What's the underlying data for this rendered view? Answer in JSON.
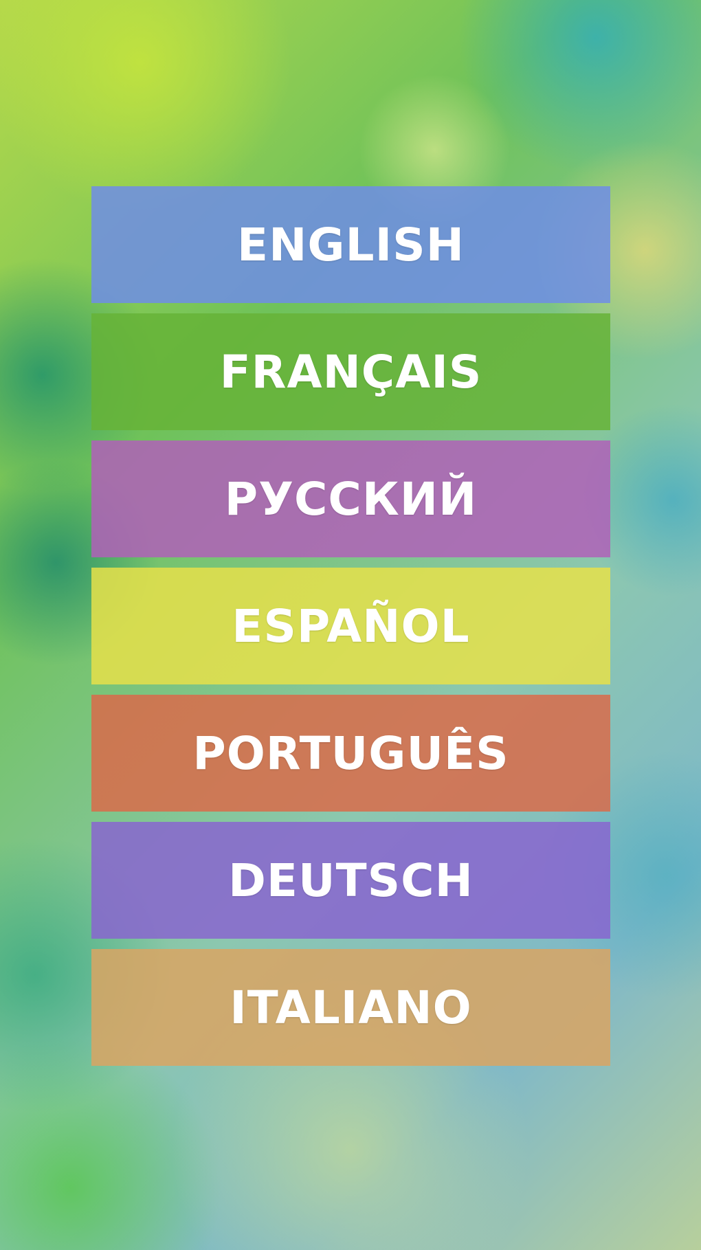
{
  "colors": {
    "english": "#6f8de6",
    "francais": "#66b337",
    "russian": "#b060b8",
    "espanol": "#e6e04a",
    "portugues": "#d96b4a",
    "deutsch": "#8865cf",
    "italiano": "#d9a563"
  },
  "languages": [
    {
      "label": "ENGLISH"
    },
    {
      "label": "FRANÇAIS"
    },
    {
      "label": "РУССКИЙ"
    },
    {
      "label": "ESPAÑOL"
    },
    {
      "label": "PORTUGUÊS"
    },
    {
      "label": "DEUTSCH"
    },
    {
      "label": "ITALIANO"
    }
  ]
}
